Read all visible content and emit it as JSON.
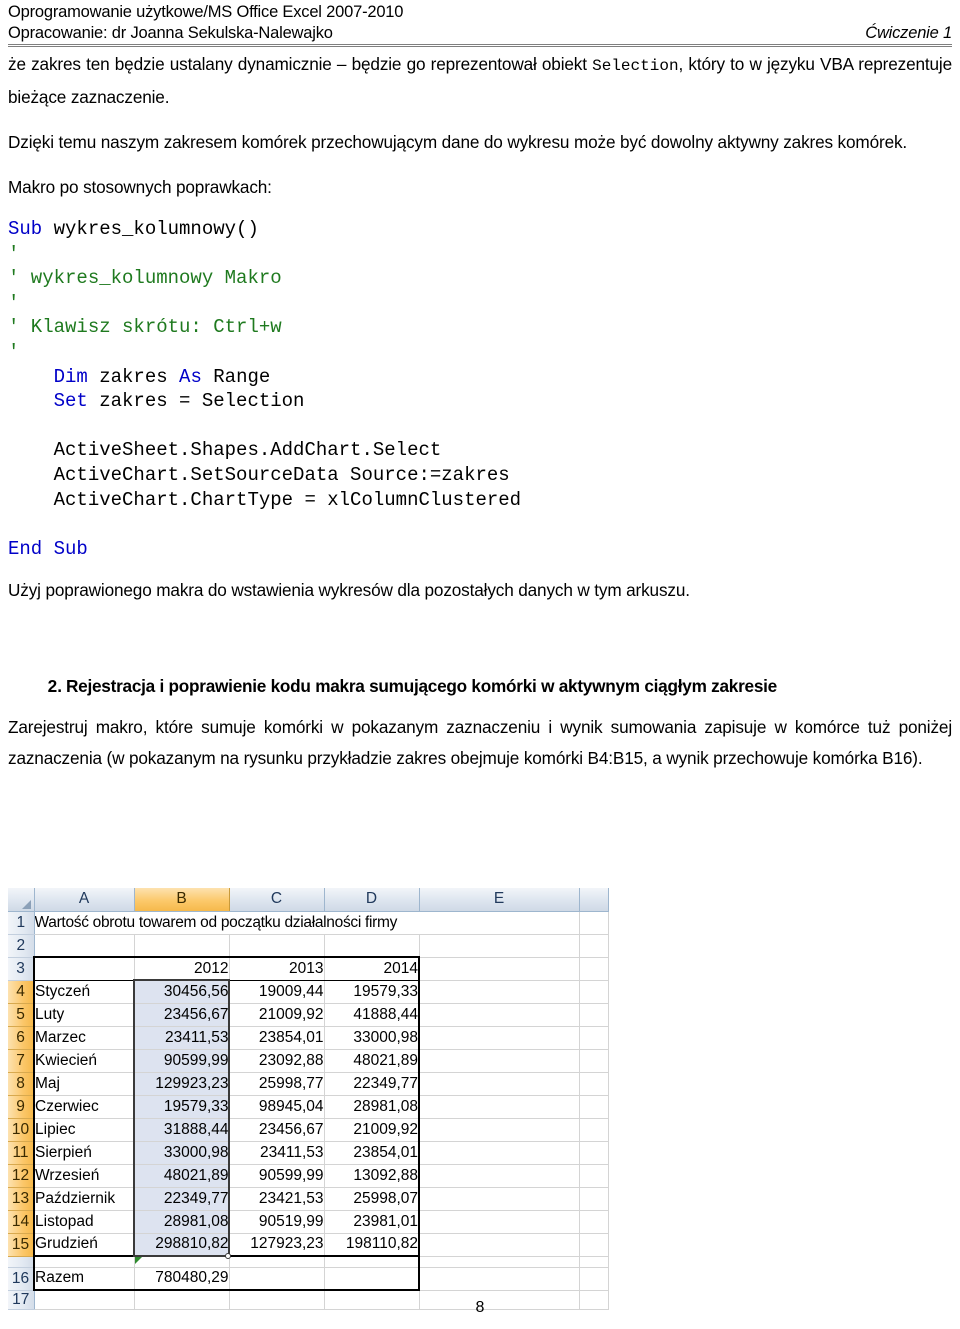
{
  "header": {
    "line1": "Oprogramowanie użytkowe/MS Office Excel 2007-2010",
    "line2_left": "Opracowanie: dr Joanna Sekulska-Nalewajko",
    "line2_right": "Ćwiczenie 1"
  },
  "body": {
    "para1_a": "że zakres ten będzie ustalany dynamicznie – będzie go reprezentował obiekt ",
    "para1_code": "Selection",
    "para1_b": ", który to w języku VBA reprezentuje bieżące zaznaczenie.",
    "para2": "Dzięki temu naszym zakresem komórek przechowującym dane do wykresu może być dowolny aktywny zakres komórek.",
    "para3": "Makro po stosownych poprawkach:",
    "para4": "Użyj poprawionego makra do wstawienia wykresów dla pozostałych danych w tym arkuszu.",
    "heading2_num": "2.",
    "heading2_text": "Rejestracja i poprawienie kodu makra sumującego komórki w aktywnym ciągłym zakresie",
    "para5": "Zarejestruj makro, które sumuje komórki w pokazanym zaznaczeniu i wynik sumowania zapisuje w komórce tuż poniżej zaznaczenia (w pokazanym na rysunku przykładzie zakres obejmuje komórki B4:B15, a wynik przechowuje komórka B16)."
  },
  "code": {
    "lines": [
      [
        {
          "t": "Sub ",
          "c": "kw"
        },
        {
          "t": "wykres_kolumnowy()",
          "c": ""
        }
      ],
      [
        {
          "t": "'",
          "c": "cmt"
        }
      ],
      [
        {
          "t": "' wykres_kolumnowy Makro",
          "c": "cmt"
        }
      ],
      [
        {
          "t": "'",
          "c": "cmt"
        }
      ],
      [
        {
          "t": "' Klawisz skrótu: Ctrl+w",
          "c": "cmt"
        }
      ],
      [
        {
          "t": "'",
          "c": "cmt"
        }
      ],
      [
        {
          "t": "    Dim ",
          "c": "kw"
        },
        {
          "t": "zakres ",
          "c": ""
        },
        {
          "t": "As ",
          "c": "kw"
        },
        {
          "t": "Range",
          "c": ""
        }
      ],
      [
        {
          "t": "    Set ",
          "c": "kw"
        },
        {
          "t": "zakres = Selection",
          "c": ""
        }
      ],
      [
        {
          "t": "",
          "c": ""
        }
      ],
      [
        {
          "t": "    ActiveSheet.Shapes.AddChart.Select",
          "c": ""
        }
      ],
      [
        {
          "t": "    ActiveChart.SetSourceData Source:=zakres",
          "c": ""
        }
      ],
      [
        {
          "t": "    ActiveChart.ChartType = xlColumnClustered",
          "c": ""
        }
      ],
      [
        {
          "t": "",
          "c": ""
        }
      ],
      [
        {
          "t": "End Sub",
          "c": "kw"
        }
      ]
    ],
    "colors": {
      "keyword": "#0000C8",
      "comment": "#1f7a1f",
      "plain": "#000000"
    }
  },
  "excel": {
    "column_headers": [
      "A",
      "B",
      "C",
      "D",
      "E"
    ],
    "selected_column": "B",
    "row_headers": [
      "1",
      "2",
      "3",
      "4",
      "5",
      "6",
      "7",
      "8",
      "9",
      "10",
      "11",
      "12",
      "13",
      "14",
      "15",
      "16",
      "17"
    ],
    "selected_rows": [
      "4",
      "5",
      "6",
      "7",
      "8",
      "9",
      "10",
      "11",
      "12",
      "13",
      "14",
      "15"
    ],
    "title_cell": "Wartość obrotu towarem od początku działalności firmy",
    "year_headers": [
      "2012",
      "2013",
      "2014"
    ],
    "rows": [
      {
        "label": "Styczeń",
        "values": [
          "30456,56",
          "19009,44",
          "19579,33"
        ]
      },
      {
        "label": "Luty",
        "values": [
          "23456,67",
          "21009,92",
          "41888,44"
        ]
      },
      {
        "label": "Marzec",
        "values": [
          "23411,53",
          "23854,01",
          "33000,98"
        ]
      },
      {
        "label": "Kwiecień",
        "values": [
          "90599,99",
          "23092,88",
          "48021,89"
        ]
      },
      {
        "label": "Maj",
        "values": [
          "129923,23",
          "25998,77",
          "22349,77"
        ]
      },
      {
        "label": "Czerwiec",
        "values": [
          "19579,33",
          "98945,04",
          "28981,08"
        ]
      },
      {
        "label": "Lipiec",
        "values": [
          "31888,44",
          "23456,67",
          "21009,92"
        ]
      },
      {
        "label": "Sierpień",
        "values": [
          "33000,98",
          "23411,53",
          "23854,01"
        ]
      },
      {
        "label": "Wrzesień",
        "values": [
          "48021,89",
          "90599,99",
          "13092,88"
        ]
      },
      {
        "label": "Październik",
        "values": [
          "22349,77",
          "23421,53",
          "25998,07"
        ]
      },
      {
        "label": "Listopad",
        "values": [
          "28981,08",
          "90519,99",
          "23981,01"
        ]
      },
      {
        "label": "Grudzień",
        "values": [
          "298810,82",
          "127923,23",
          "198110,82"
        ]
      }
    ],
    "total_row": {
      "label": "Razem",
      "values": [
        "780480,29",
        "",
        ""
      ]
    },
    "selection_range": "B4:B15",
    "result_cell": "B16",
    "colors": {
      "header_selected": "#f6b94b",
      "header_normal": "#dde5ef",
      "selection_fill": "#dde3f0",
      "grid_line": "#d4d4d4"
    }
  },
  "footer": {
    "page_number": "8"
  }
}
